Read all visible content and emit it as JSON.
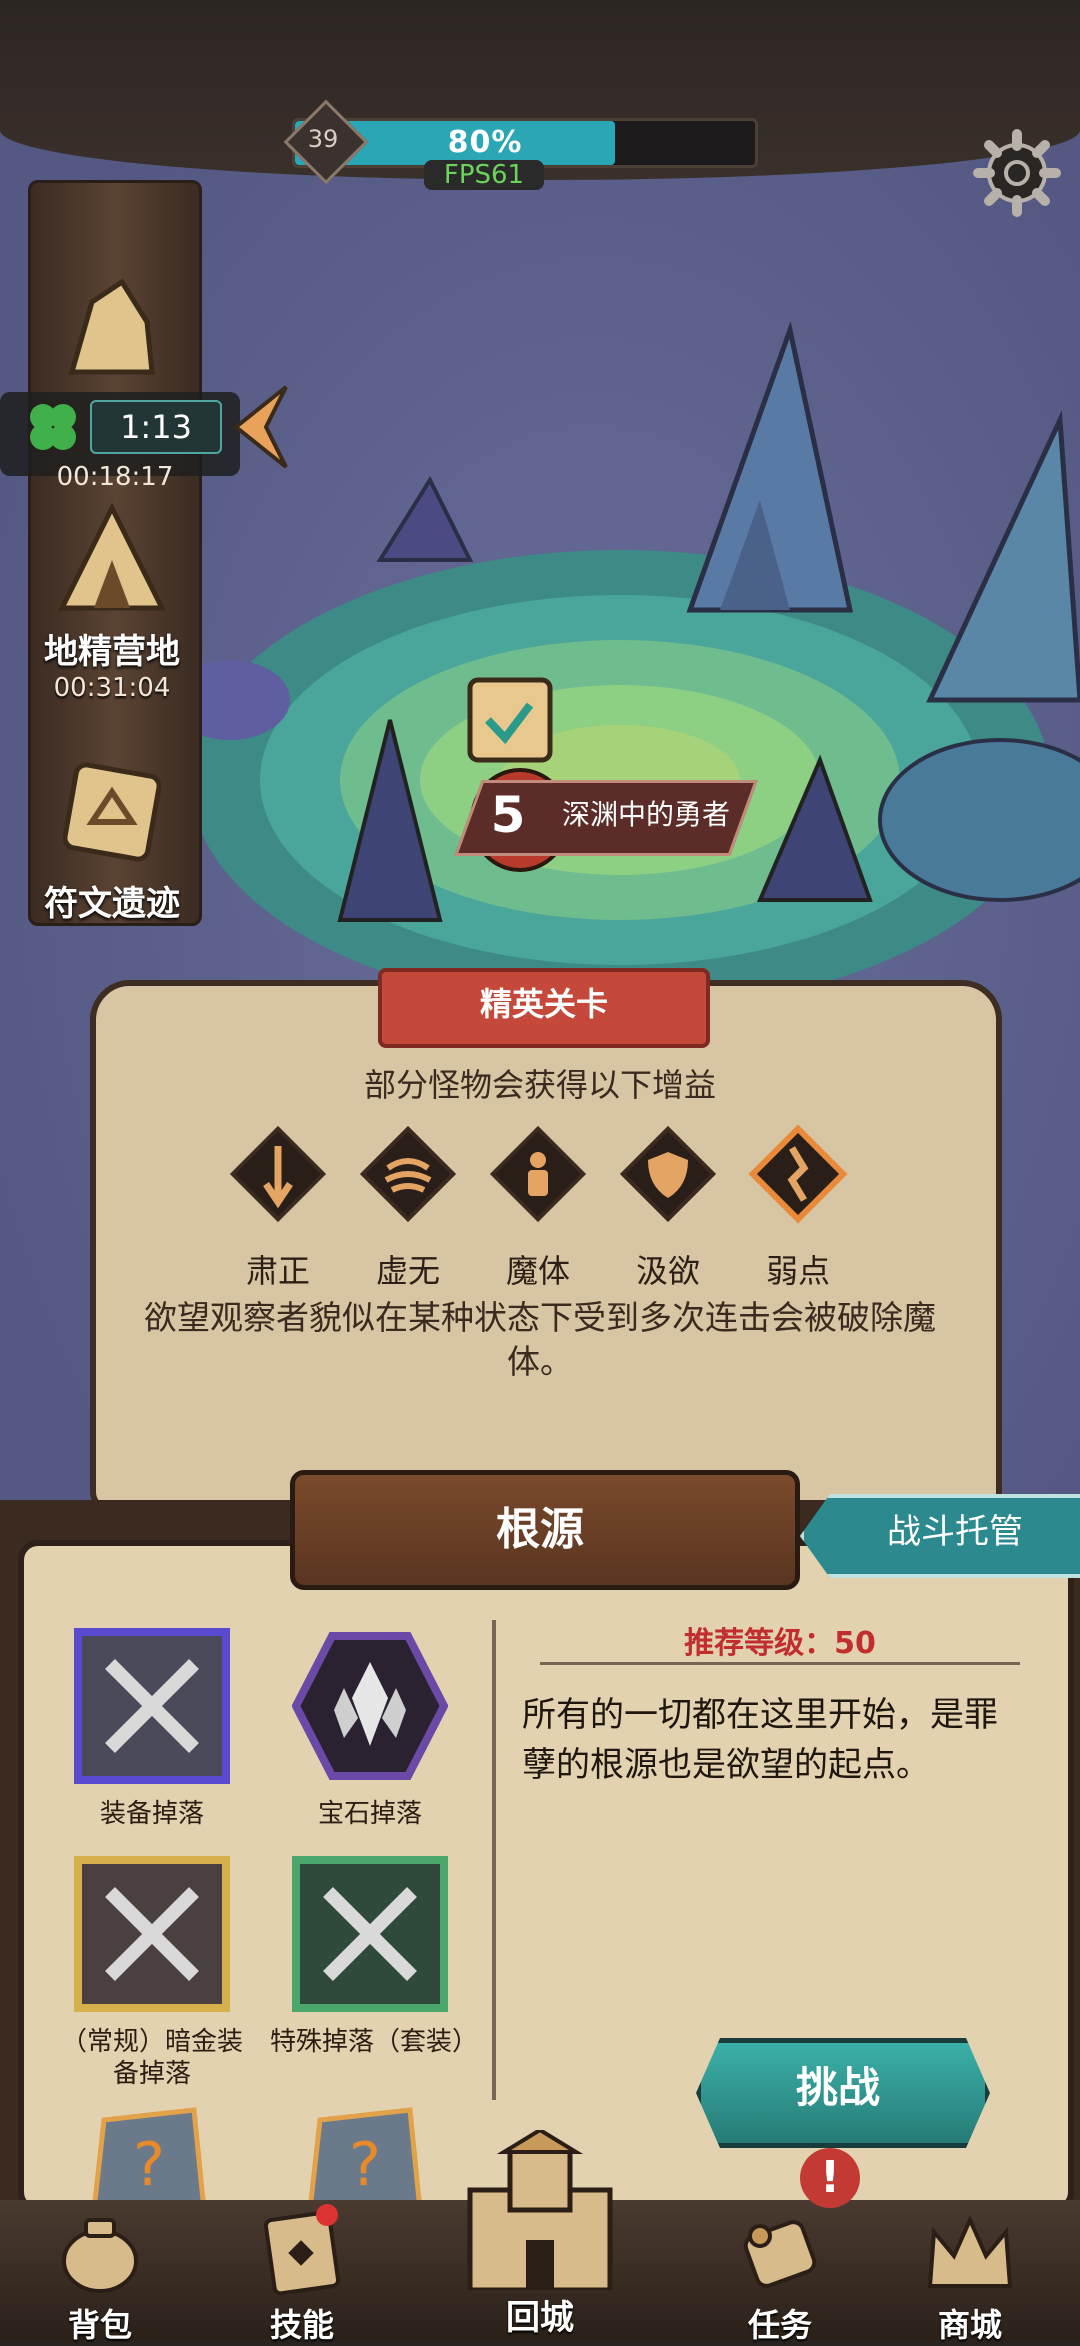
{
  "hud": {
    "level": "39",
    "progress_percent": 80,
    "progress_text": "80%",
    "fps": "FPS61"
  },
  "side": {
    "timer": "1:13",
    "node1_time": "00:18:17",
    "node2_name": "地精营地",
    "node2_time": "00:31:04",
    "node3_name": "符文遗迹"
  },
  "stage": {
    "number": "5",
    "name": "深渊中的勇者"
  },
  "elite": {
    "tag": "精英关卡",
    "subtitle": "部分怪物会获得以下增益",
    "buffs": [
      {
        "name": "肃正",
        "icon": "sword-down-icon"
      },
      {
        "name": "虚无",
        "icon": "void-icon"
      },
      {
        "name": "魔体",
        "icon": "demon-body-icon"
      },
      {
        "name": "汲欲",
        "icon": "shield-icon"
      },
      {
        "name": "弱点",
        "icon": "cracked-icon"
      }
    ],
    "description": "欲望观察者貌似在某种状态下受到多次连击会被破除魔体。"
  },
  "root": {
    "title": "根源",
    "auto_battle": "战斗托管",
    "recommended_level": "推荐等级：50",
    "description": "所有的一切都在这里开始，是罪孽的根源也是欲望的起点。",
    "challenge": "挑战",
    "drops": [
      {
        "label": "装备掉落"
      },
      {
        "label": "宝石掉落"
      },
      {
        "label": "（常规）暗金装备掉落"
      },
      {
        "label": "特殊掉落（套装）"
      }
    ]
  },
  "nav": {
    "bag": "背包",
    "skills": "技能",
    "town": "回城",
    "quest": "任务",
    "shop": "商城",
    "quest_alert": "!"
  },
  "colors": {
    "accent_teal": "#2aa6b5",
    "elite_red": "#c4493a",
    "rec_red": "#c12e2e"
  }
}
